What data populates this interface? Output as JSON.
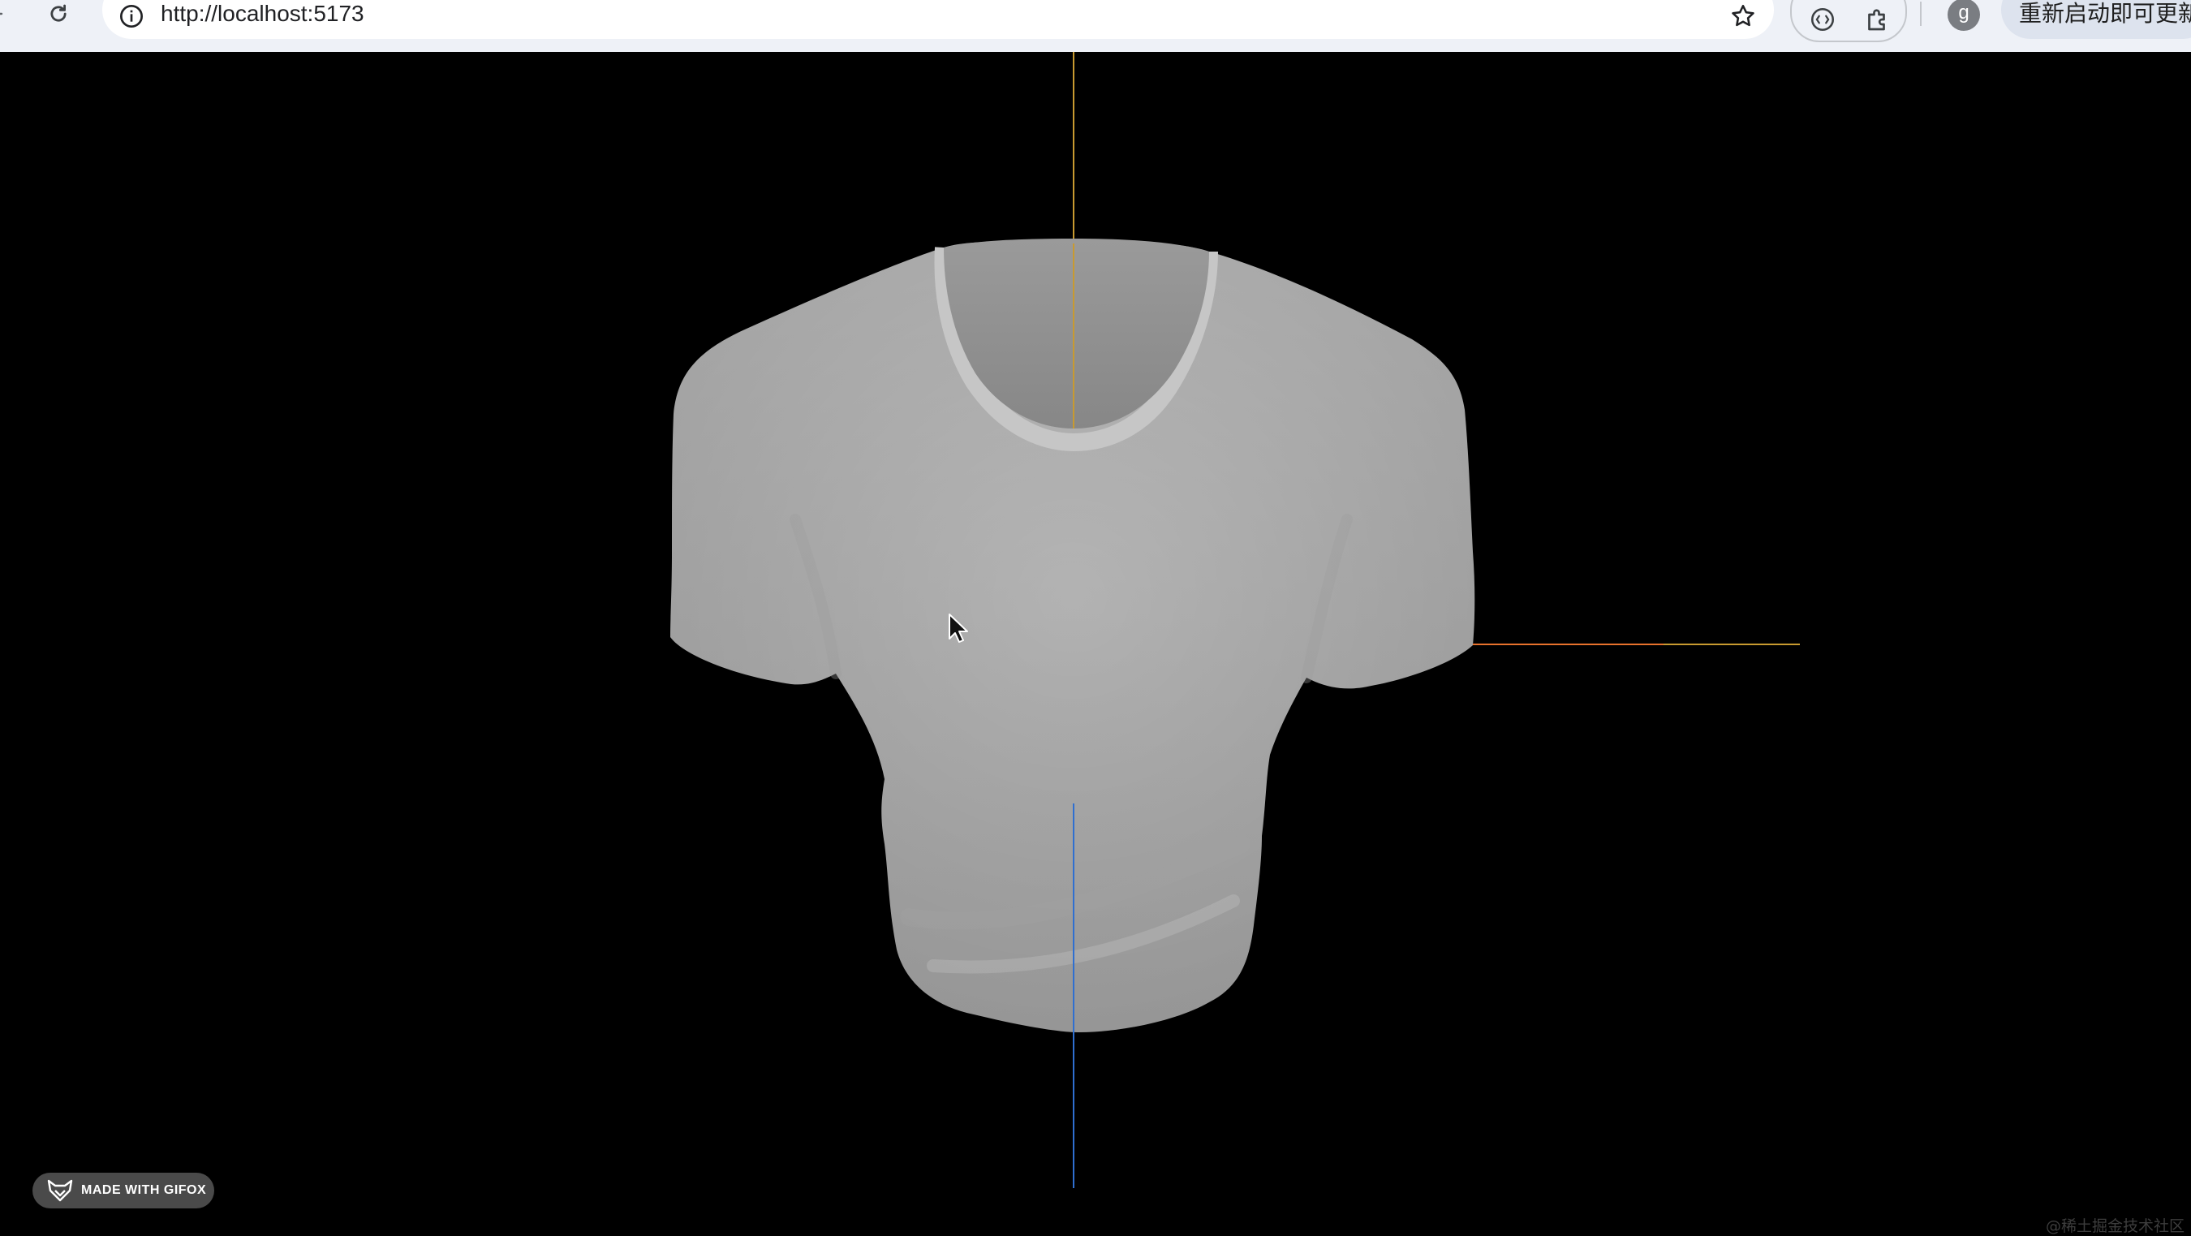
{
  "browser": {
    "url": "http://localhost:5173",
    "profile_initial": "g",
    "update_label": "重新启动即可更新",
    "icons": [
      "back-icon",
      "reload-icon",
      "site-info-icon",
      "bookmark-star-icon",
      "extension-icon",
      "puzzle-icon",
      "profile-avatar"
    ]
  },
  "scene": {
    "background": "#000000",
    "model": "t-shirt",
    "model_color": "#b4b4b4",
    "axes": {
      "x_color": "#e8722c",
      "y_color": "#c89a30",
      "z_color": "#2f6fd0"
    }
  },
  "overlay": {
    "badge_text": "MADE WITH GIFOX",
    "watermark": "@稀土掘金技术社区"
  }
}
